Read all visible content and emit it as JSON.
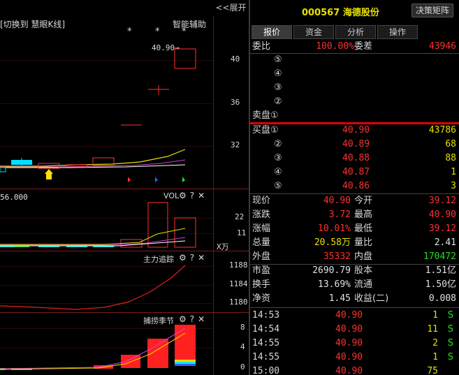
{
  "left": {
    "expand_label": "<<展开",
    "kline_title": "[切换到 慧眼K线]",
    "smart_assist": "智能辅助",
    "price_tag": "40.90→",
    "y_ticks": [
      "40",
      "36",
      "32"
    ],
    "stars": [
      "*",
      "*",
      "*"
    ],
    "vol_label": "VOL",
    "vol_ma_text": "56.000",
    "vol_ticks": [
      "22",
      "11"
    ],
    "vol_unit": "X万",
    "main_track_label": "主力追踪",
    "main_track_ticks": [
      "1188",
      "1184",
      "1180"
    ],
    "season_label": "捕捞季节",
    "season_ticks": [
      "8",
      "4",
      "0"
    ],
    "marker_label": "B",
    "icon_gear": "⚙",
    "icon_help": "?",
    "icon_close": "✕"
  },
  "right": {
    "stock_code": "000567",
    "stock_name": "海德股份",
    "decision_button": "决策矩阵",
    "tabs": [
      "报价",
      "资金",
      "分析",
      "操作"
    ],
    "weibi": {
      "label": "委比",
      "value": "100.00%",
      "label2": "委差",
      "value2": "43946"
    },
    "sell_orders": [
      {
        "label": "⑤",
        "price": "",
        "vol": ""
      },
      {
        "label": "④",
        "price": "",
        "vol": ""
      },
      {
        "label": "③",
        "price": "",
        "vol": ""
      },
      {
        "label": "②",
        "price": "",
        "vol": ""
      },
      {
        "label": "卖盘①",
        "price": "",
        "vol": ""
      }
    ],
    "buy_orders": [
      {
        "label": "买盘①",
        "price": "40.90",
        "vol": "43786"
      },
      {
        "label": "②",
        "price": "40.89",
        "vol": "68"
      },
      {
        "label": "③",
        "price": "40.88",
        "vol": "88"
      },
      {
        "label": "④",
        "price": "40.87",
        "vol": "1"
      },
      {
        "label": "⑤",
        "price": "40.86",
        "vol": "3"
      }
    ],
    "stats": [
      {
        "l1": "现价",
        "v1": "40.90",
        "c1": "red",
        "l2": "今开",
        "v2": "39.12",
        "c2": "red"
      },
      {
        "l1": "涨跌",
        "v1": "3.72",
        "c1": "red",
        "l2": "最高",
        "v2": "40.90",
        "c2": "red"
      },
      {
        "l1": "涨幅",
        "v1": "10.01%",
        "c1": "red",
        "l2": "最低",
        "v2": "39.12",
        "c2": "red"
      },
      {
        "l1": "总量",
        "v1": "20.58万",
        "c1": "yel",
        "l2": "量比",
        "v2": "2.41",
        "c2": "wht"
      },
      {
        "l1": "外盘",
        "v1": "35332",
        "c1": "red",
        "l2": "内盘",
        "v2": "170472",
        "c2": "grn"
      },
      {
        "l1": "市盈",
        "v1": "2690.79",
        "c1": "wht",
        "l2": "股本",
        "v2": "1.51亿",
        "c2": "wht"
      },
      {
        "l1": "换手",
        "v1": "13.69%",
        "c1": "wht",
        "l2": "流通",
        "v2": "1.50亿",
        "c2": "wht"
      },
      {
        "l1": "净资",
        "v1": "1.45",
        "c1": "wht",
        "l2": "收益(二)",
        "v2": "0.008",
        "c2": "wht"
      }
    ],
    "ticks": [
      {
        "time": "14:53",
        "price": "40.90",
        "vol": "1",
        "side": "S"
      },
      {
        "time": "14:54",
        "price": "40.90",
        "vol": "11",
        "side": "S"
      },
      {
        "time": "14:55",
        "price": "40.90",
        "vol": "2",
        "side": "S"
      },
      {
        "time": "14:55",
        "price": "40.90",
        "vol": "1",
        "side": "S"
      },
      {
        "time": "15:00",
        "price": "40.90",
        "vol": "75",
        "side": ""
      }
    ]
  },
  "colors": {
    "up": "#ff3030",
    "down": "#00e0ff",
    "volume_text": "#e8e000",
    "sell": "#20e020",
    "separator": "#e00000"
  }
}
